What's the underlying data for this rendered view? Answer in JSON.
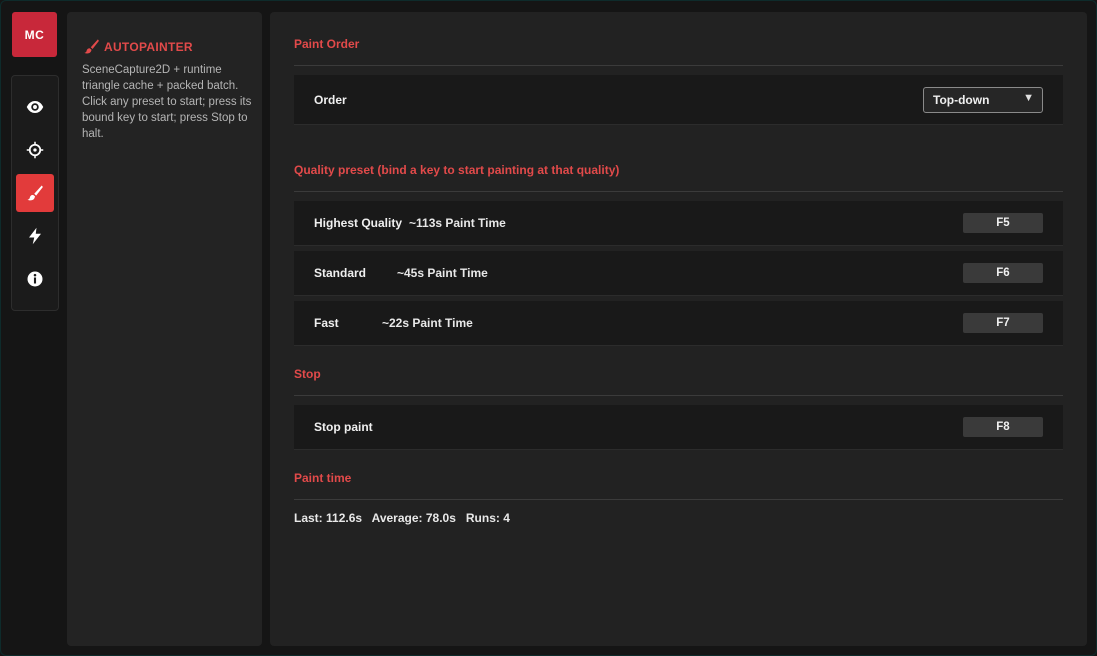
{
  "logo": {
    "text": "MC"
  },
  "rail": {
    "items": [
      {
        "icon": "eye-icon",
        "active": false
      },
      {
        "icon": "crosshair-icon",
        "active": false
      },
      {
        "icon": "brush-icon",
        "active": true
      },
      {
        "icon": "lightning-icon",
        "active": false
      },
      {
        "icon": "info-icon",
        "active": false
      }
    ]
  },
  "info": {
    "title": "AUTOPAINTER",
    "description": "SceneCapture2D + runtime triangle cache + packed batch. Click any preset to start; press its bound key to start; press Stop to halt."
  },
  "main": {
    "paint_order": {
      "title": "Paint Order",
      "label": "Order",
      "selected": "Top-down"
    },
    "quality": {
      "title": "Quality preset  (bind a key to start painting at that quality)",
      "presets": [
        {
          "name": "Highest Quality",
          "time": "~113s Paint Time",
          "key": "F5"
        },
        {
          "name": "Standard",
          "time": "~45s Paint Time",
          "key": "F6"
        },
        {
          "name": "Fast",
          "time": "~22s Paint Time",
          "key": "F7"
        }
      ]
    },
    "stop": {
      "title": "Stop",
      "label": "Stop paint",
      "key": "F8"
    },
    "paint_time": {
      "title": "Paint time",
      "stats": "Last: 112.6s   Average: 78.0s   Runs: 4"
    }
  },
  "colors": {
    "accent": "#e24a4a",
    "logo_bg": "#c8283a",
    "active_tab": "#e23b3b"
  }
}
